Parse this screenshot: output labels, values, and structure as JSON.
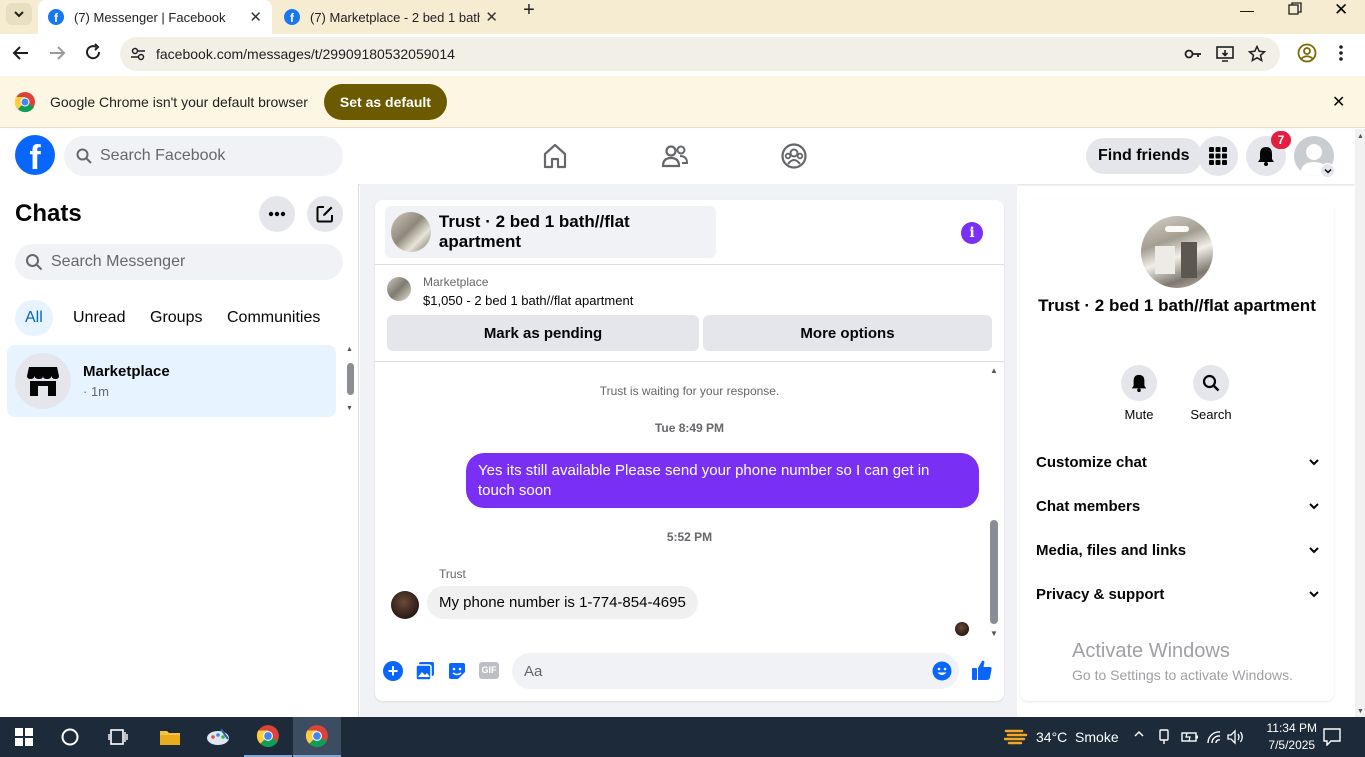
{
  "browser": {
    "tabs": [
      {
        "title": "(7) Messenger | Facebook",
        "active": true
      },
      {
        "title": "(7) Marketplace - 2 bed 1 bath/"
      }
    ],
    "url": "facebook.com/messages/t/29909180532059014",
    "infobar": {
      "message": "Google Chrome isn't your default browser",
      "button": "Set as default"
    }
  },
  "fb_header": {
    "search_placeholder": "Search Facebook",
    "find_friends": "Find friends",
    "notification_count": "7"
  },
  "chats": {
    "title": "Chats",
    "search_placeholder": "Search Messenger",
    "filters": [
      "All",
      "Unread",
      "Groups",
      "Communities"
    ],
    "active_filter": "All",
    "items": [
      {
        "name": "Marketplace",
        "meta": "· 1m"
      }
    ]
  },
  "conversation": {
    "title": "Trust · 2 bed 1 bath//flat apartment",
    "listing": {
      "source": "Marketplace",
      "price_title": "$1,050 - 2 bed 1 bath//flat apartment"
    },
    "buttons": {
      "pending": "Mark as pending",
      "more": "More options"
    },
    "messages": [
      {
        "type": "note",
        "text": "Trust is waiting for your response."
      },
      {
        "type": "time",
        "text": "Tue 8:49 PM"
      },
      {
        "type": "out",
        "text": "Yes its still available Please send your phone number so I can get in touch soon"
      },
      {
        "type": "time",
        "text": "5:52 PM"
      },
      {
        "type": "in",
        "sender": "Trust",
        "text": "My phone number is 1-774-854-4695"
      }
    ],
    "composer_placeholder": "Aa",
    "accent": "#7a2ff4"
  },
  "details": {
    "name": "Trust · 2 bed 1 bath//flat apartment",
    "actions": [
      {
        "label": "Mute",
        "icon": "bell-icon"
      },
      {
        "label": "Search",
        "icon": "search-icon"
      }
    ],
    "sections": [
      "Customize chat",
      "Chat members",
      "Media, files and links",
      "Privacy & support"
    ]
  },
  "watermark": {
    "line1": "Activate Windows",
    "line2": "Go to Settings to activate Windows."
  },
  "taskbar": {
    "weather": "34°C  Smoke",
    "time": "11:34 PM",
    "date": "7/5/2025"
  }
}
